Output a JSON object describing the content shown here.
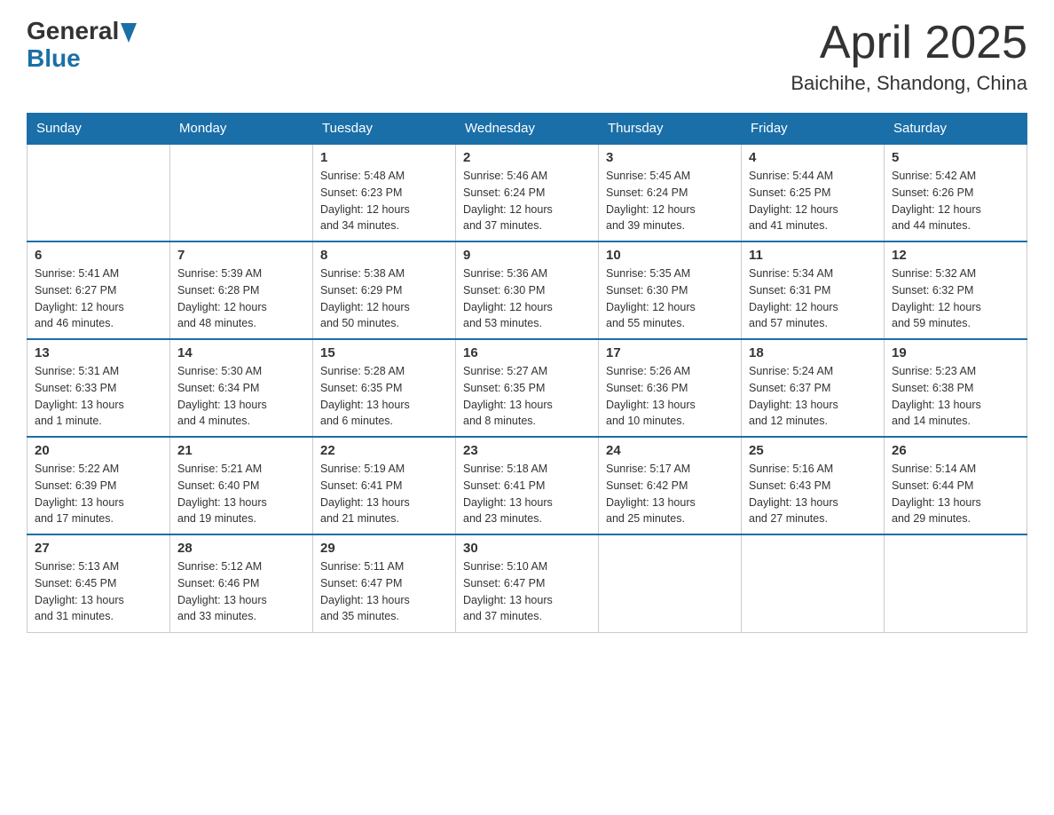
{
  "header": {
    "logo_general": "General",
    "logo_blue": "Blue",
    "title": "April 2025",
    "subtitle": "Baichihe, Shandong, China"
  },
  "weekdays": [
    "Sunday",
    "Monday",
    "Tuesday",
    "Wednesday",
    "Thursday",
    "Friday",
    "Saturday"
  ],
  "weeks": [
    [
      {
        "day": "",
        "info": ""
      },
      {
        "day": "",
        "info": ""
      },
      {
        "day": "1",
        "info": "Sunrise: 5:48 AM\nSunset: 6:23 PM\nDaylight: 12 hours\nand 34 minutes."
      },
      {
        "day": "2",
        "info": "Sunrise: 5:46 AM\nSunset: 6:24 PM\nDaylight: 12 hours\nand 37 minutes."
      },
      {
        "day": "3",
        "info": "Sunrise: 5:45 AM\nSunset: 6:24 PM\nDaylight: 12 hours\nand 39 minutes."
      },
      {
        "day": "4",
        "info": "Sunrise: 5:44 AM\nSunset: 6:25 PM\nDaylight: 12 hours\nand 41 minutes."
      },
      {
        "day": "5",
        "info": "Sunrise: 5:42 AM\nSunset: 6:26 PM\nDaylight: 12 hours\nand 44 minutes."
      }
    ],
    [
      {
        "day": "6",
        "info": "Sunrise: 5:41 AM\nSunset: 6:27 PM\nDaylight: 12 hours\nand 46 minutes."
      },
      {
        "day": "7",
        "info": "Sunrise: 5:39 AM\nSunset: 6:28 PM\nDaylight: 12 hours\nand 48 minutes."
      },
      {
        "day": "8",
        "info": "Sunrise: 5:38 AM\nSunset: 6:29 PM\nDaylight: 12 hours\nand 50 minutes."
      },
      {
        "day": "9",
        "info": "Sunrise: 5:36 AM\nSunset: 6:30 PM\nDaylight: 12 hours\nand 53 minutes."
      },
      {
        "day": "10",
        "info": "Sunrise: 5:35 AM\nSunset: 6:30 PM\nDaylight: 12 hours\nand 55 minutes."
      },
      {
        "day": "11",
        "info": "Sunrise: 5:34 AM\nSunset: 6:31 PM\nDaylight: 12 hours\nand 57 minutes."
      },
      {
        "day": "12",
        "info": "Sunrise: 5:32 AM\nSunset: 6:32 PM\nDaylight: 12 hours\nand 59 minutes."
      }
    ],
    [
      {
        "day": "13",
        "info": "Sunrise: 5:31 AM\nSunset: 6:33 PM\nDaylight: 13 hours\nand 1 minute."
      },
      {
        "day": "14",
        "info": "Sunrise: 5:30 AM\nSunset: 6:34 PM\nDaylight: 13 hours\nand 4 minutes."
      },
      {
        "day": "15",
        "info": "Sunrise: 5:28 AM\nSunset: 6:35 PM\nDaylight: 13 hours\nand 6 minutes."
      },
      {
        "day": "16",
        "info": "Sunrise: 5:27 AM\nSunset: 6:35 PM\nDaylight: 13 hours\nand 8 minutes."
      },
      {
        "day": "17",
        "info": "Sunrise: 5:26 AM\nSunset: 6:36 PM\nDaylight: 13 hours\nand 10 minutes."
      },
      {
        "day": "18",
        "info": "Sunrise: 5:24 AM\nSunset: 6:37 PM\nDaylight: 13 hours\nand 12 minutes."
      },
      {
        "day": "19",
        "info": "Sunrise: 5:23 AM\nSunset: 6:38 PM\nDaylight: 13 hours\nand 14 minutes."
      }
    ],
    [
      {
        "day": "20",
        "info": "Sunrise: 5:22 AM\nSunset: 6:39 PM\nDaylight: 13 hours\nand 17 minutes."
      },
      {
        "day": "21",
        "info": "Sunrise: 5:21 AM\nSunset: 6:40 PM\nDaylight: 13 hours\nand 19 minutes."
      },
      {
        "day": "22",
        "info": "Sunrise: 5:19 AM\nSunset: 6:41 PM\nDaylight: 13 hours\nand 21 minutes."
      },
      {
        "day": "23",
        "info": "Sunrise: 5:18 AM\nSunset: 6:41 PM\nDaylight: 13 hours\nand 23 minutes."
      },
      {
        "day": "24",
        "info": "Sunrise: 5:17 AM\nSunset: 6:42 PM\nDaylight: 13 hours\nand 25 minutes."
      },
      {
        "day": "25",
        "info": "Sunrise: 5:16 AM\nSunset: 6:43 PM\nDaylight: 13 hours\nand 27 minutes."
      },
      {
        "day": "26",
        "info": "Sunrise: 5:14 AM\nSunset: 6:44 PM\nDaylight: 13 hours\nand 29 minutes."
      }
    ],
    [
      {
        "day": "27",
        "info": "Sunrise: 5:13 AM\nSunset: 6:45 PM\nDaylight: 13 hours\nand 31 minutes."
      },
      {
        "day": "28",
        "info": "Sunrise: 5:12 AM\nSunset: 6:46 PM\nDaylight: 13 hours\nand 33 minutes."
      },
      {
        "day": "29",
        "info": "Sunrise: 5:11 AM\nSunset: 6:47 PM\nDaylight: 13 hours\nand 35 minutes."
      },
      {
        "day": "30",
        "info": "Sunrise: 5:10 AM\nSunset: 6:47 PM\nDaylight: 13 hours\nand 37 minutes."
      },
      {
        "day": "",
        "info": ""
      },
      {
        "day": "",
        "info": ""
      },
      {
        "day": "",
        "info": ""
      }
    ]
  ]
}
